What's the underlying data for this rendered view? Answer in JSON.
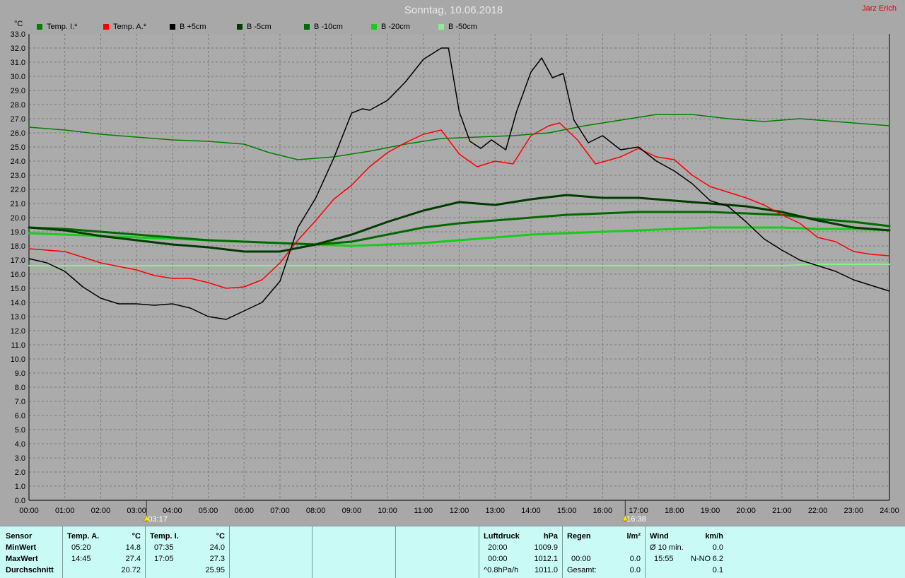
{
  "title": "Sonntag, 10.06.2018",
  "owner": "Jarz Erich",
  "chart_data": {
    "type": "line",
    "unit_label": "°C",
    "ylim": [
      0,
      33
    ],
    "xlim": [
      0,
      24
    ],
    "grid": true,
    "legend_position": "top",
    "y_ticks": [
      "0.0",
      "1.0",
      "2.0",
      "3.0",
      "4.0",
      "5.0",
      "6.0",
      "7.0",
      "8.0",
      "9.0",
      "10.0",
      "11.0",
      "12.0",
      "13.0",
      "14.0",
      "15.0",
      "16.0",
      "17.0",
      "18.0",
      "19.0",
      "20.0",
      "21.0",
      "22.0",
      "23.0",
      "24.0",
      "25.0",
      "26.0",
      "27.0",
      "28.0",
      "29.0",
      "30.0",
      "31.0",
      "32.0",
      "33.0"
    ],
    "x_ticks": [
      "00:00",
      "01:00",
      "02:00",
      "03:00",
      "04:00",
      "05:00",
      "06:00",
      "07:00",
      "08:00",
      "09:00",
      "10:00",
      "11:00",
      "12:00",
      "13:00",
      "14:00",
      "15:00",
      "16:00",
      "17:00",
      "18:00",
      "19:00",
      "20:00",
      "21:00",
      "22:00",
      "23:00",
      "24:00"
    ],
    "markers": [
      {
        "label": "03:17",
        "x": 3.28
      },
      {
        "label": "16:38",
        "x": 16.63
      }
    ],
    "series": [
      {
        "name": "Temp. I.*",
        "color": "#008000",
        "width": 1.5,
        "points": [
          [
            0,
            26.4
          ],
          [
            1,
            26.2
          ],
          [
            2,
            25.9
          ],
          [
            3,
            25.7
          ],
          [
            4,
            25.5
          ],
          [
            5,
            25.4
          ],
          [
            6,
            25.2
          ],
          [
            6.7,
            24.6
          ],
          [
            7.5,
            24.1
          ],
          [
            8.5,
            24.3
          ],
          [
            9.5,
            24.7
          ],
          [
            10.5,
            25.2
          ],
          [
            11.5,
            25.6
          ],
          [
            12.5,
            25.7
          ],
          [
            13.5,
            25.8
          ],
          [
            14.5,
            26.0
          ],
          [
            15.5,
            26.5
          ],
          [
            16.5,
            26.9
          ],
          [
            17.5,
            27.3
          ],
          [
            18.5,
            27.3
          ],
          [
            19.5,
            27.0
          ],
          [
            20.5,
            26.8
          ],
          [
            21.5,
            27.0
          ],
          [
            22.5,
            26.8
          ],
          [
            23.5,
            26.6
          ],
          [
            24,
            26.5
          ]
        ]
      },
      {
        "name": "Temp. A.*",
        "color": "#ff0000",
        "width": 1.5,
        "points": [
          [
            0,
            17.8
          ],
          [
            1,
            17.6
          ],
          [
            2,
            16.8
          ],
          [
            3,
            16.3
          ],
          [
            3.5,
            15.9
          ],
          [
            4,
            15.7
          ],
          [
            4.5,
            15.7
          ],
          [
            5,
            15.4
          ],
          [
            5.5,
            15.0
          ],
          [
            6,
            15.1
          ],
          [
            6.5,
            15.6
          ],
          [
            7,
            16.8
          ],
          [
            7.5,
            18.4
          ],
          [
            8,
            19.8
          ],
          [
            8.5,
            21.3
          ],
          [
            9,
            22.3
          ],
          [
            9.5,
            23.6
          ],
          [
            10,
            24.6
          ],
          [
            10.5,
            25.3
          ],
          [
            11,
            25.9
          ],
          [
            11.5,
            26.2
          ],
          [
            12,
            24.5
          ],
          [
            12.5,
            23.6
          ],
          [
            13,
            24.0
          ],
          [
            13.5,
            23.8
          ],
          [
            14,
            25.8
          ],
          [
            14.5,
            26.5
          ],
          [
            14.8,
            26.7
          ],
          [
            15.3,
            25.5
          ],
          [
            15.8,
            23.8
          ],
          [
            16.5,
            24.3
          ],
          [
            17,
            24.9
          ],
          [
            17.5,
            24.3
          ],
          [
            18,
            24.1
          ],
          [
            18.5,
            23.0
          ],
          [
            19,
            22.2
          ],
          [
            19.5,
            21.8
          ],
          [
            20,
            21.4
          ],
          [
            20.5,
            20.9
          ],
          [
            21,
            20.2
          ],
          [
            21.5,
            19.6
          ],
          [
            22,
            18.6
          ],
          [
            22.5,
            18.3
          ],
          [
            23,
            17.6
          ],
          [
            23.5,
            17.4
          ],
          [
            24,
            17.3
          ]
        ]
      },
      {
        "name": "B +5cm",
        "color": "#000000",
        "width": 1.5,
        "points": [
          [
            0,
            17.1
          ],
          [
            0.5,
            16.8
          ],
          [
            1,
            16.2
          ],
          [
            1.5,
            15.1
          ],
          [
            2,
            14.3
          ],
          [
            2.5,
            13.9
          ],
          [
            3,
            13.9
          ],
          [
            3.5,
            13.8
          ],
          [
            4,
            13.9
          ],
          [
            4.5,
            13.6
          ],
          [
            5,
            13.0
          ],
          [
            5.5,
            12.8
          ],
          [
            6,
            13.4
          ],
          [
            6.5,
            14.0
          ],
          [
            7,
            15.5
          ],
          [
            7.5,
            19.3
          ],
          [
            8,
            21.4
          ],
          [
            8.5,
            24.2
          ],
          [
            9,
            27.4
          ],
          [
            9.3,
            27.7
          ],
          [
            9.5,
            27.6
          ],
          [
            10,
            28.3
          ],
          [
            10.5,
            29.6
          ],
          [
            11,
            31.2
          ],
          [
            11.5,
            32.0
          ],
          [
            11.7,
            32.0
          ],
          [
            12,
            27.5
          ],
          [
            12.3,
            25.4
          ],
          [
            12.6,
            24.9
          ],
          [
            12.9,
            25.5
          ],
          [
            13.3,
            24.8
          ],
          [
            13.6,
            27.5
          ],
          [
            14,
            30.3
          ],
          [
            14.3,
            31.3
          ],
          [
            14.6,
            29.9
          ],
          [
            14.9,
            30.2
          ],
          [
            15.2,
            26.9
          ],
          [
            15.6,
            25.3
          ],
          [
            16,
            25.8
          ],
          [
            16.5,
            24.8
          ],
          [
            17,
            25.0
          ],
          [
            17.5,
            24.0
          ],
          [
            18,
            23.3
          ],
          [
            18.5,
            22.4
          ],
          [
            19,
            21.2
          ],
          [
            19.5,
            20.8
          ],
          [
            20,
            19.7
          ],
          [
            20.5,
            18.5
          ],
          [
            21,
            17.7
          ],
          [
            21.5,
            17.0
          ],
          [
            22,
            16.6
          ],
          [
            22.5,
            16.2
          ],
          [
            23,
            15.6
          ],
          [
            23.5,
            15.2
          ],
          [
            24,
            14.8
          ]
        ]
      },
      {
        "name": "B -5cm",
        "color": "#003c00",
        "width": 3,
        "points": [
          [
            0,
            19.3
          ],
          [
            1,
            19.1
          ],
          [
            2,
            18.7
          ],
          [
            3,
            18.4
          ],
          [
            4,
            18.1
          ],
          [
            5,
            17.9
          ],
          [
            6,
            17.6
          ],
          [
            7,
            17.6
          ],
          [
            8,
            18.1
          ],
          [
            9,
            18.8
          ],
          [
            10,
            19.7
          ],
          [
            11,
            20.5
          ],
          [
            12,
            21.1
          ],
          [
            13,
            20.9
          ],
          [
            14,
            21.3
          ],
          [
            15,
            21.6
          ],
          [
            16,
            21.4
          ],
          [
            17,
            21.4
          ],
          [
            18,
            21.2
          ],
          [
            19,
            21.0
          ],
          [
            20,
            20.8
          ],
          [
            21,
            20.4
          ],
          [
            22,
            19.8
          ],
          [
            23,
            19.3
          ],
          [
            24,
            19.1
          ]
        ]
      },
      {
        "name": "B -10cm",
        "color": "#006a00",
        "width": 3,
        "points": [
          [
            0,
            19.3
          ],
          [
            1,
            19.2
          ],
          [
            2,
            19.0
          ],
          [
            3,
            18.8
          ],
          [
            4,
            18.6
          ],
          [
            5,
            18.4
          ],
          [
            6,
            18.3
          ],
          [
            7,
            18.2
          ],
          [
            8,
            18.1
          ],
          [
            9,
            18.3
          ],
          [
            10,
            18.8
          ],
          [
            11,
            19.3
          ],
          [
            12,
            19.6
          ],
          [
            13,
            19.8
          ],
          [
            14,
            20.0
          ],
          [
            15,
            20.2
          ],
          [
            16,
            20.3
          ],
          [
            17,
            20.4
          ],
          [
            18,
            20.4
          ],
          [
            19,
            20.4
          ],
          [
            20,
            20.3
          ],
          [
            21,
            20.2
          ],
          [
            22,
            19.9
          ],
          [
            23,
            19.7
          ],
          [
            24,
            19.4
          ]
        ]
      },
      {
        "name": "B -20cm",
        "color": "#18cc18",
        "width": 3,
        "points": [
          [
            0,
            18.9
          ],
          [
            1,
            18.8
          ],
          [
            2,
            18.7
          ],
          [
            3,
            18.6
          ],
          [
            4,
            18.5
          ],
          [
            5,
            18.4
          ],
          [
            6,
            18.3
          ],
          [
            7,
            18.2
          ],
          [
            8,
            18.1
          ],
          [
            9,
            18.0
          ],
          [
            10,
            18.1
          ],
          [
            11,
            18.2
          ],
          [
            12,
            18.4
          ],
          [
            13,
            18.6
          ],
          [
            14,
            18.8
          ],
          [
            15,
            18.9
          ],
          [
            16,
            19.0
          ],
          [
            17,
            19.1
          ],
          [
            18,
            19.2
          ],
          [
            19,
            19.3
          ],
          [
            20,
            19.3
          ],
          [
            21,
            19.3
          ],
          [
            22,
            19.2
          ],
          [
            23,
            19.2
          ],
          [
            24,
            19.1
          ]
        ]
      },
      {
        "name": "B -50cm",
        "color": "#88f088",
        "width": 2,
        "points": [
          [
            0,
            16.6
          ],
          [
            6,
            16.6
          ],
          [
            12,
            16.6
          ],
          [
            18,
            16.6
          ],
          [
            21,
            16.6
          ],
          [
            22,
            16.7
          ],
          [
            24,
            16.7
          ]
        ]
      }
    ]
  },
  "stats": {
    "sensor": {
      "header": "Sensor",
      "min": "MinWert",
      "max": "MaxWert",
      "avg": "Durchschnitt"
    },
    "temp_a": {
      "header": "Temp. A.",
      "unit": "°C",
      "min_time": "05:20",
      "min_val": "14.8",
      "max_time": "14:45",
      "max_val": "27.4",
      "avg_val": "20.72"
    },
    "temp_i": {
      "header": "Temp. I.",
      "unit": "°C",
      "min_time": "07:35",
      "min_val": "24.0",
      "max_time": "17:05",
      "max_val": "27.3",
      "avg_val": "25.95"
    },
    "pressure": {
      "header": "Luftdruck",
      "unit": "hPa",
      "r1_label": "20:00",
      "r1_val": "1009.9",
      "r2_label": "00:00",
      "r2_val": "1012.1",
      "r3_label": "^0.8hPa/h",
      "r3_val": "1011.0"
    },
    "rain": {
      "header": "Regen",
      "unit": "l/m²",
      "r1_label": "",
      "r1_val": "",
      "r2_label": "00:00",
      "r2_val": "0.0",
      "r3_label": "Gesamt:",
      "r3_val": "0.0"
    },
    "wind": {
      "header": "Wind",
      "unit": "km/h",
      "r1_label": "Ø 10 min.",
      "r1_val": "0.0",
      "r2_label": "15:55",
      "r2_dir": "N-NO",
      "r2_val": "6.2",
      "r3_val": "0.1"
    }
  }
}
